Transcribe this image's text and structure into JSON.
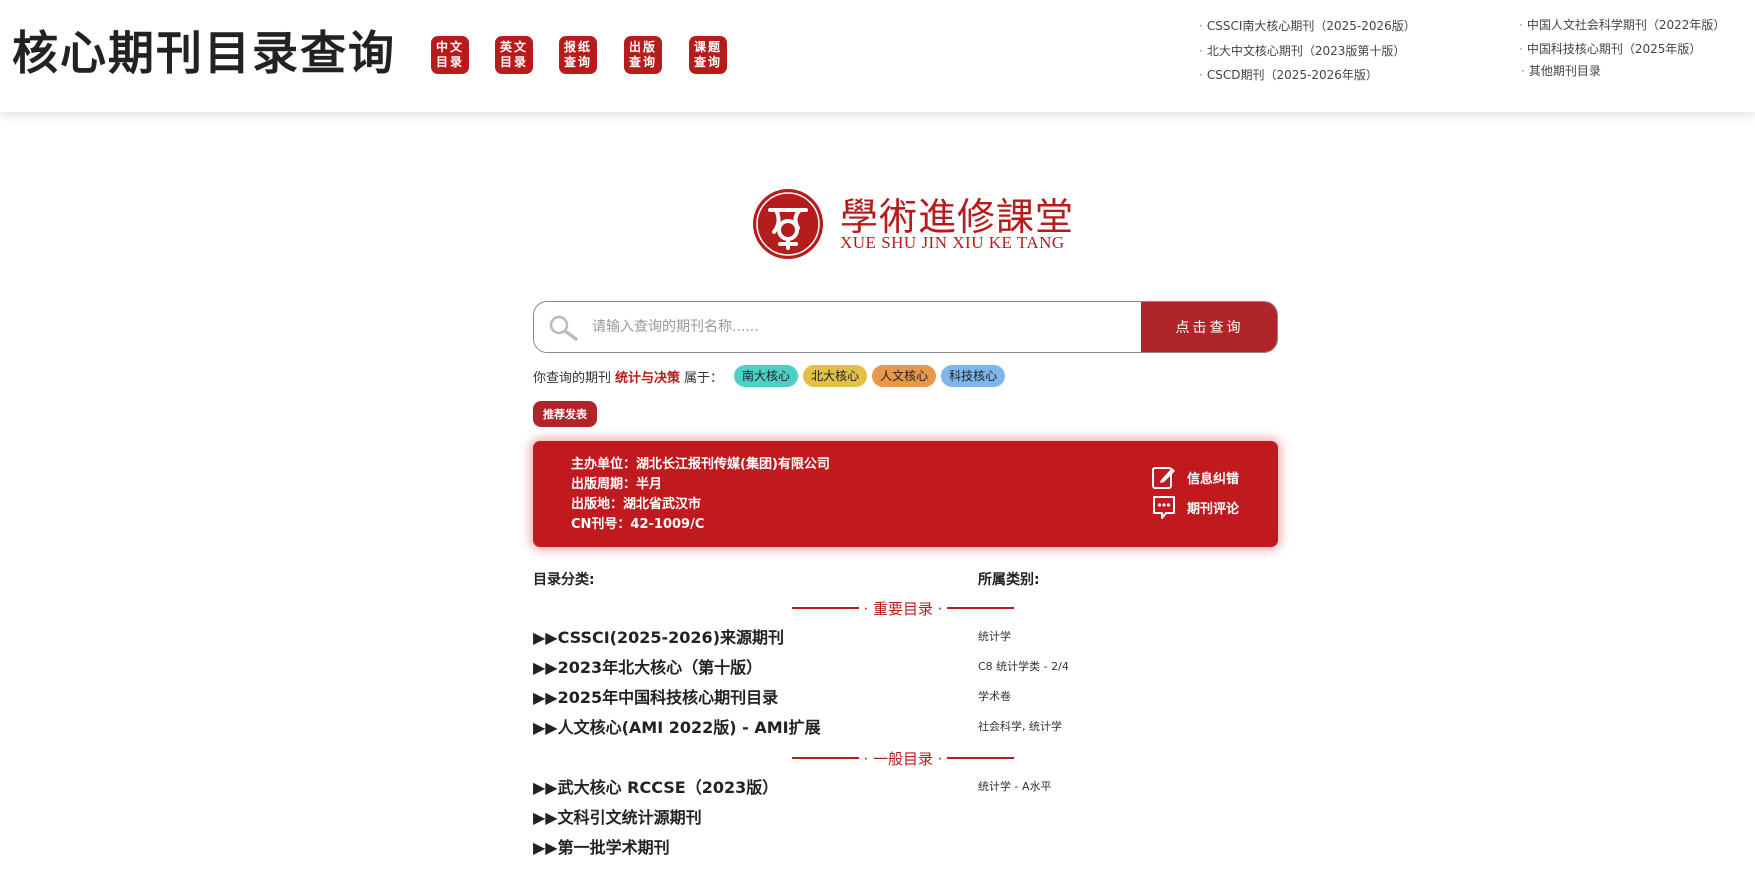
{
  "header": {
    "title": "核心期刊目录查询",
    "nav_buttons": [
      {
        "line1": "中文",
        "line2": "目录"
      },
      {
        "line1": "英文",
        "line2": "目录"
      },
      {
        "line1": "报纸",
        "line2": "查询"
      },
      {
        "line1": "出版",
        "line2": "查询"
      },
      {
        "line1": "课题",
        "line2": "查询"
      }
    ],
    "links": [
      "CSSCI南大核心期刊（2025-2026版）",
      "北大中文核心期刊（2023版第十版）",
      "CSCD期刊（2025-2026年版）",
      "中国人文社会科学期刊（2022年版）",
      "中国科技核心期刊（2025年版）",
      "其他期刊目录"
    ],
    "link_bullet": "·"
  },
  "logo": {
    "cn": "學術進修課堂",
    "en": "XUE SHU JIN XIU KE TANG"
  },
  "search": {
    "placeholder": "请输入查询的期刊名称......",
    "button": "点击查询"
  },
  "belongs": {
    "prefix": "你查询的期刊",
    "journal": "统计与决策",
    "suffix": "属于：",
    "tags": [
      {
        "label": "南大核心",
        "color": "#4dd0c4"
      },
      {
        "label": "北大核心",
        "color": "#e0c046"
      },
      {
        "label": "人文核心",
        "color": "#e8984a"
      },
      {
        "label": "科技核心",
        "color": "#7fb6ea"
      }
    ]
  },
  "recommend": "推荐发表",
  "info": {
    "lines": [
      "主办单位：湖北长江报刊传媒(集团)有限公司",
      "出版周期：半月",
      "出版地：湖北省武汉市",
      "CN刊号：42-1009/C"
    ],
    "actions": [
      "信息纠错",
      "期刊评论"
    ]
  },
  "catalog": {
    "col_category": "目录分类:",
    "col_class": "所属类别:",
    "sections": [
      {
        "title": "· 重要目录 ·",
        "items": [
          {
            "name": "▶▶CSSCI(2025-2026)来源期刊",
            "class": "统计学"
          },
          {
            "name": "▶▶2023年北大核心（第十版）",
            "class": "C8 统计学类 - 2/4"
          },
          {
            "name": "▶▶2025年中国科技核心期刊目录",
            "class": "学术卷"
          },
          {
            "name": "▶▶人文核心(AMI 2022版) - AMI扩展",
            "class": "社会科学, 统计学"
          }
        ]
      },
      {
        "title": "· 一般目录 ·",
        "items": [
          {
            "name": "▶▶武大核心 RCCSE（2023版）",
            "class": "统计学 - A水平"
          },
          {
            "name": "▶▶文科引文统计源期刊",
            "class": ""
          },
          {
            "name": "▶▶第一批学术期刊",
            "class": ""
          }
        ]
      }
    ]
  },
  "colors": {
    "brand_red": "#b71c1c",
    "card_red": "#c0191e"
  }
}
